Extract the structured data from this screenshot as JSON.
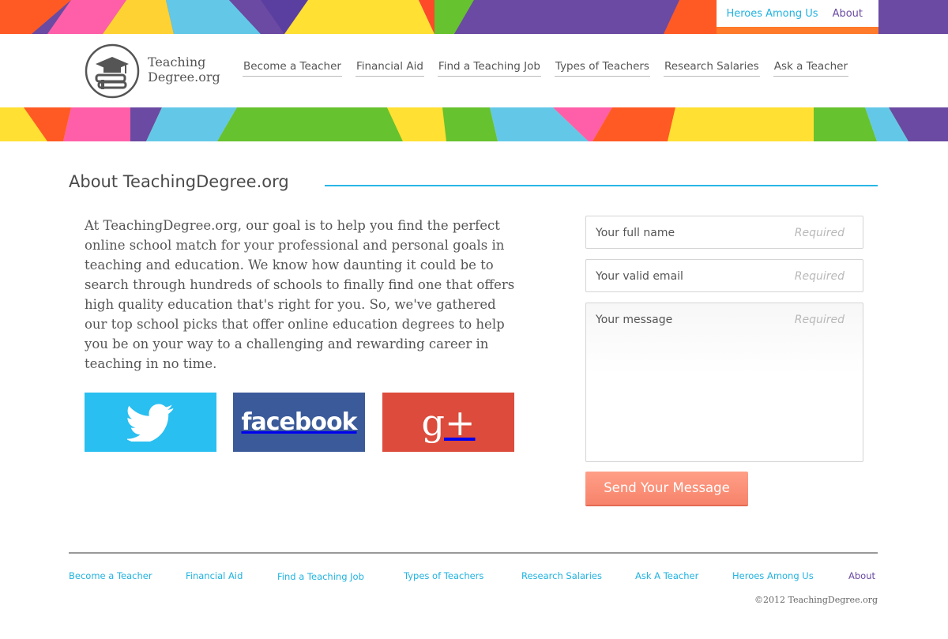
{
  "colors": {
    "accent_blue": "#29b6e6",
    "accent_purple": "#6a4aa2",
    "twitter": "#29bff0",
    "facebook": "#3b5a9a",
    "google": "#dc4b3b",
    "send_button": "#f98c74"
  },
  "utility_nav": {
    "heroes": "Heroes Among Us",
    "about": "About"
  },
  "logo": {
    "line1": "Teaching",
    "line2": "Degree.org",
    "icon": "books-graduation-cap-icon"
  },
  "main_nav": [
    "Become a Teacher",
    "Financial Aid",
    "Find a Teaching Job",
    "Types of Teachers",
    "Research Salaries",
    "Ask a Teacher"
  ],
  "section": {
    "title": "About TeachingDegree.org",
    "body": "At TeachingDegree.org, our goal is to help you find the perfect online school match for your professional and personal goals in teaching and education. We know how daunting it could be to search through hundreds of schools to finally find one that offers high quality education that's right for you. So, we've gathered our top school picks that offer online education degrees to help you be on your way to a challenging and rewarding career in teaching in no time."
  },
  "social": {
    "facebook": "facebook",
    "google": "g+",
    "twitter_icon": "twitter-bird-icon"
  },
  "form": {
    "name_placeholder": "Your full name",
    "email_placeholder": "Your valid email",
    "message_placeholder": "Your message",
    "required": "Required",
    "send": "Send Your Message"
  },
  "footer": {
    "links": [
      "Become a Teacher",
      "Financial Aid",
      "Find a Teaching Job",
      "Types of Teachers",
      "Research Salaries",
      "Ask A Teacher",
      "Heroes Among Us",
      "About"
    ],
    "copyright": "©2012 TeachingDegree.org"
  }
}
